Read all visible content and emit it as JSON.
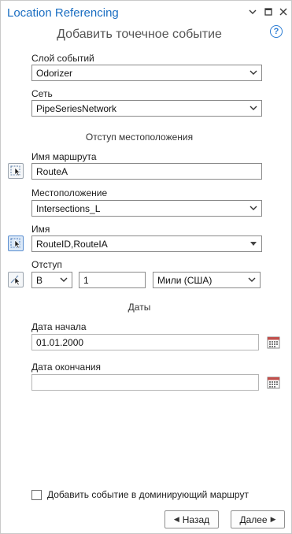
{
  "window": {
    "title": "Location Referencing"
  },
  "header": {
    "subtitle": "Добавить точечное событие",
    "help": "?"
  },
  "form": {
    "event_layer": {
      "label": "Слой событий",
      "value": "Odorizer"
    },
    "network": {
      "label": "Сеть",
      "value": "PipeSeriesNetwork"
    },
    "location_offset_section": "Отступ местоположения",
    "route_name": {
      "label": "Имя маршрута",
      "value": "RouteA"
    },
    "location": {
      "label": "Местоположение",
      "value": "Intersections_L"
    },
    "name": {
      "label": "Имя",
      "value": "RouteID,RouteIA"
    },
    "offset": {
      "label": "Отступ",
      "direction": "В",
      "value": "1",
      "units": "Мили (США)"
    },
    "dates_section": "Даты",
    "start_date": {
      "label": "Дата начала",
      "value": "01.01.2000"
    },
    "end_date": {
      "label": "Дата окончания",
      "value": ""
    },
    "dominant_route": {
      "label": "Добавить событие в доминирующий маршрут",
      "checked": false
    }
  },
  "buttons": {
    "back": "Назад",
    "next": "Далее"
  },
  "colors": {
    "title": "#1b6ec2",
    "accent": "#2b7cd3"
  },
  "icons": [
    "menu-chevron-icon",
    "maximize-icon",
    "close-icon",
    "help-icon",
    "route-pick-icon",
    "point-pick-icon",
    "offset-pick-icon",
    "calendar-icon"
  ]
}
